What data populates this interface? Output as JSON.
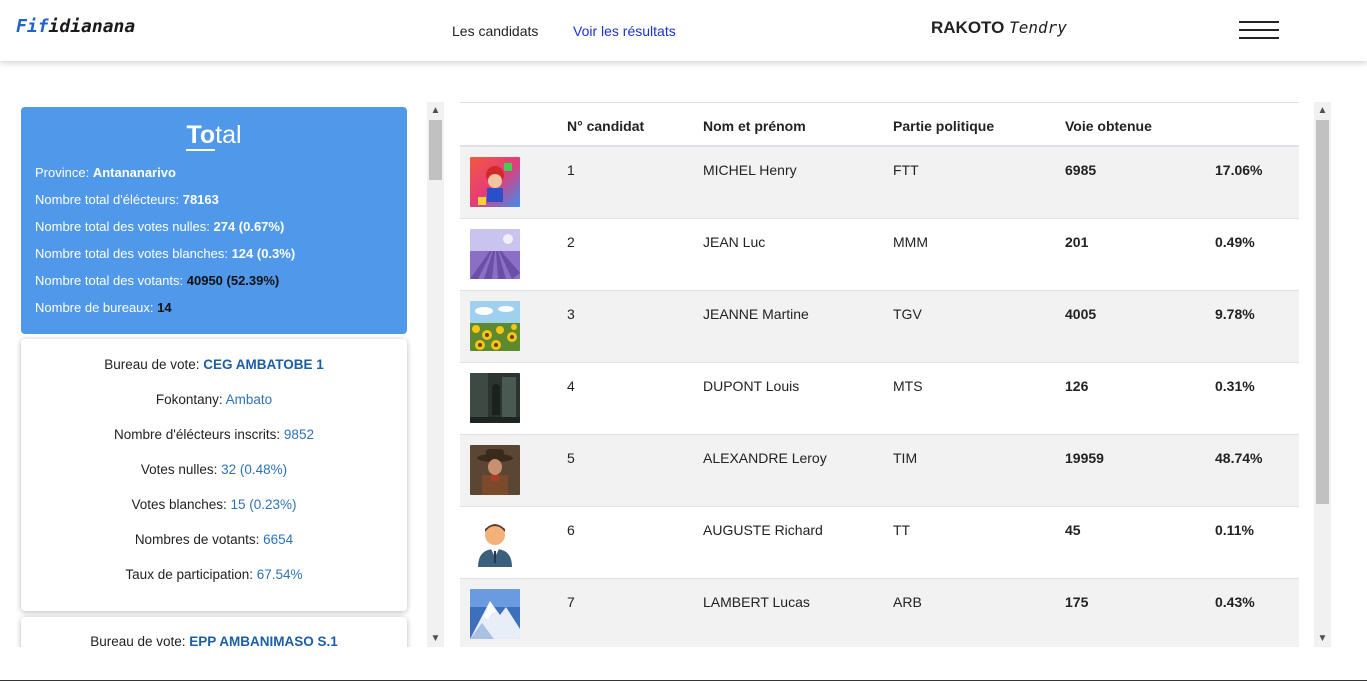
{
  "header": {
    "brand_part1": "Fif",
    "brand_part2": "idianana",
    "nav": {
      "candidates": "Les candidats",
      "results": "Voir les résultats"
    },
    "user": {
      "last_name": "RAKOTO",
      "first_name": "Tendry"
    },
    "menu_icon": "hamburger-icon"
  },
  "total": {
    "title_underlined": "To",
    "title_rest": "tal",
    "province_label": "Province: ",
    "province_value": "Antananarivo",
    "electors_label": "Nombre total d'élécteurs: ",
    "electors_value": "78163",
    "nulls_label": "Nombre total des votes nulles: ",
    "nulls_value": "274 (0.67%)",
    "blanks_label": "Nombre total des votes blanches: ",
    "blanks_value": "124 (0.3%)",
    "voters_label": "Nombre total des votants: ",
    "voters_value": "40950 (52.39%)",
    "offices_label": "Nombre de bureaux: ",
    "offices_value": "14"
  },
  "bureaux": [
    {
      "office_label": "Bureau de vote: ",
      "office_value": "CEG AMBATOBE 1",
      "fokontany_label": "Fokontany: ",
      "fokontany_value": "Ambato",
      "registered_label": "Nombre d'élécteurs inscrits: ",
      "registered_value": "9852",
      "nulls_label": "Votes nulles: ",
      "nulls_value": "32 (0.48%)",
      "blanks_label": "Votes blanches: ",
      "blanks_value": "15 (0.23%)",
      "voters_label": "Nombres de votants: ",
      "voters_value": "6654",
      "rate_label": "Taux de participation: ",
      "rate_value": "67.54%"
    },
    {
      "office_label": "Bureau de vote: ",
      "office_value": "EPP AMBANIMASO S.1"
    }
  ],
  "table": {
    "headers": [
      "N° candidat",
      "Nom et prénom",
      "Partie politique",
      "Voie obtenue"
    ],
    "rows": [
      {
        "number": "1",
        "name": "MICHEL Henry",
        "party": "FTT",
        "votes": "6985",
        "percent": "17.06%",
        "photo": "mario-artwork"
      },
      {
        "number": "2",
        "name": "JEAN Luc",
        "party": "MMM",
        "votes": "201",
        "percent": "0.49%",
        "photo": "lavender-field"
      },
      {
        "number": "3",
        "name": "JEANNE Martine",
        "party": "TGV",
        "votes": "4005",
        "percent": "9.78%",
        "photo": "sunflower-field"
      },
      {
        "number": "4",
        "name": "DUPONT Louis",
        "party": "MTS",
        "votes": "126",
        "percent": "0.31%",
        "photo": "dark-game-scene"
      },
      {
        "number": "5",
        "name": "ALEXANDRE Leroy",
        "party": "TIM",
        "votes": "19959",
        "percent": "48.74%",
        "photo": "cowboy-portrait"
      },
      {
        "number": "6",
        "name": "AUGUSTE Richard",
        "party": "TT",
        "votes": "45",
        "percent": "0.11%",
        "photo": "default-avatar"
      },
      {
        "number": "7",
        "name": "LAMBERT Lucas",
        "party": "ARB",
        "votes": "175",
        "percent": "0.43%",
        "photo": "snowy-mountain"
      }
    ]
  },
  "colors": {
    "accent": "#4f98ea",
    "link": "#1a33cc",
    "brand_blue": "#1f63c6",
    "value_blue": "#2d72b8"
  }
}
